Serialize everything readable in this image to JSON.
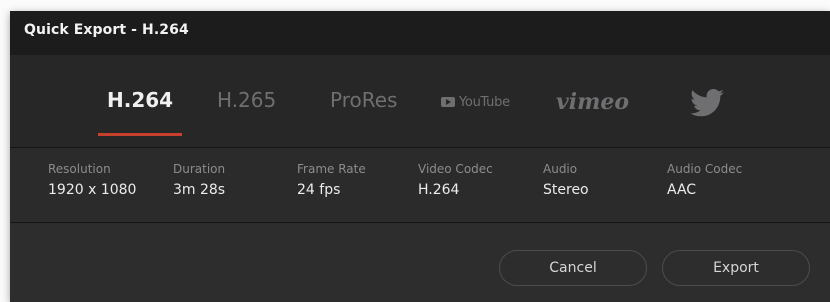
{
  "dialog": {
    "title": "Quick Export - H.264"
  },
  "presets": {
    "items": [
      {
        "label": "H.264",
        "active": true
      },
      {
        "label": "H.265",
        "active": false
      },
      {
        "label": "ProRes",
        "active": false
      },
      {
        "label": "YouTube",
        "icon": "youtube-logo-icon"
      },
      {
        "label": "vimeo",
        "icon": "vimeo-logo-icon"
      },
      {
        "label": "",
        "icon": "twitter-bird-icon"
      }
    ]
  },
  "info": {
    "columns": [
      {
        "label": "Resolution",
        "value": "1920 x 1080"
      },
      {
        "label": "Duration",
        "value": "3m 28s"
      },
      {
        "label": "Frame Rate",
        "value": "24 fps"
      },
      {
        "label": "Video Codec",
        "value": "H.264"
      },
      {
        "label": "Audio",
        "value": "Stereo"
      },
      {
        "label": "Audio Codec",
        "value": "AAC"
      }
    ]
  },
  "buttons": {
    "cancel": "Cancel",
    "export": "Export"
  },
  "colors": {
    "accent": "#c6402d",
    "background": "#2d2d2e",
    "titlebar": "#1c1c1d"
  }
}
